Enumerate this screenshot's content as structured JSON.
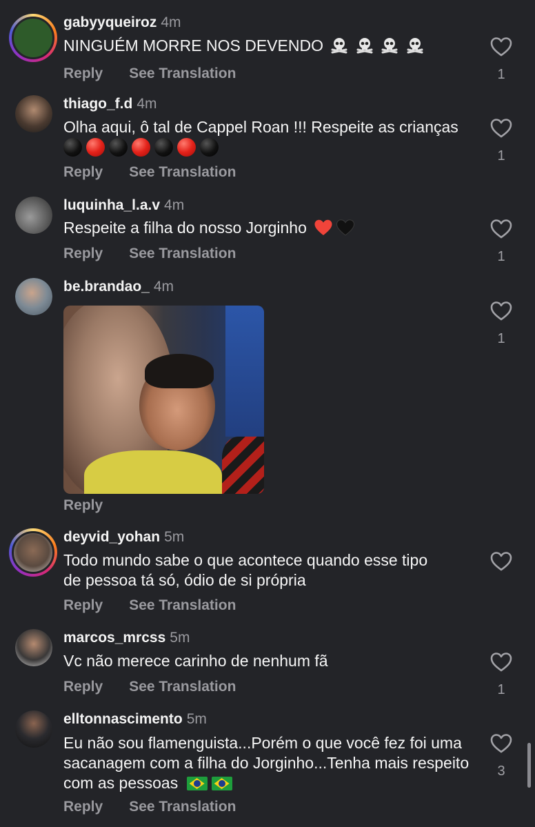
{
  "actions": {
    "reply": "Reply",
    "see_translation": "See Translation"
  },
  "comments": [
    {
      "username": "gabyyqueiroz",
      "time": "4m",
      "text": "NINGUÉM MORRE NOS DEVENDO",
      "emoji": [
        "skull-crossbones",
        "skull-crossbones",
        "skull-crossbones",
        "skull-crossbones"
      ],
      "likes": "1",
      "story_ring": true,
      "avatar_color": "#2e5b2a"
    },
    {
      "username": "thiago_f.d",
      "time": "4m",
      "text": "Olha aqui, ô tal de Cappel Roan !!! Respeite as crianças",
      "emoji": [
        "black-circle",
        "red-circle",
        "black-circle",
        "red-circle",
        "black-circle",
        "red-circle",
        "black-circle"
      ],
      "likes": "1",
      "story_ring": false,
      "avatar_color": "#4a3a30"
    },
    {
      "username": "luquinha_l.a.v",
      "time": "4m",
      "text": "Respeite a filha do nosso Jorginho",
      "emoji": [
        "red-heart",
        "black-heart"
      ],
      "likes": "1",
      "story_ring": false,
      "avatar_color": "#6d6d6d"
    },
    {
      "username": "be.brandao_",
      "time": "4m",
      "text": "",
      "has_image": true,
      "likes": "1",
      "story_ring": false,
      "avatar_color": "#7d8a95"
    },
    {
      "username": "deyvid_yohan",
      "time": "5m",
      "text": "Todo mundo sabe o que acontece quando esse tipo de pessoa tá só, ódio de si própria",
      "likes": "",
      "story_ring": true,
      "avatar_color": "#8a6a55"
    },
    {
      "username": "marcos_mrcss",
      "time": "5m",
      "text": "Vc não merece carinho de nenhum fã",
      "likes": "1",
      "story_ring": false,
      "avatar_color": "#3a3838"
    },
    {
      "username": "elltonnascimento",
      "time": "5m",
      "text": "Eu não sou flamenguista...Porém o que você fez foi uma sacanagem com a filha do Jorginho...Tenha mais respeito com as pessoas",
      "emoji": [
        "flag-brazil",
        "flag-brazil"
      ],
      "likes": "3",
      "story_ring": false,
      "avatar_color": "#2a2a2e"
    }
  ]
}
